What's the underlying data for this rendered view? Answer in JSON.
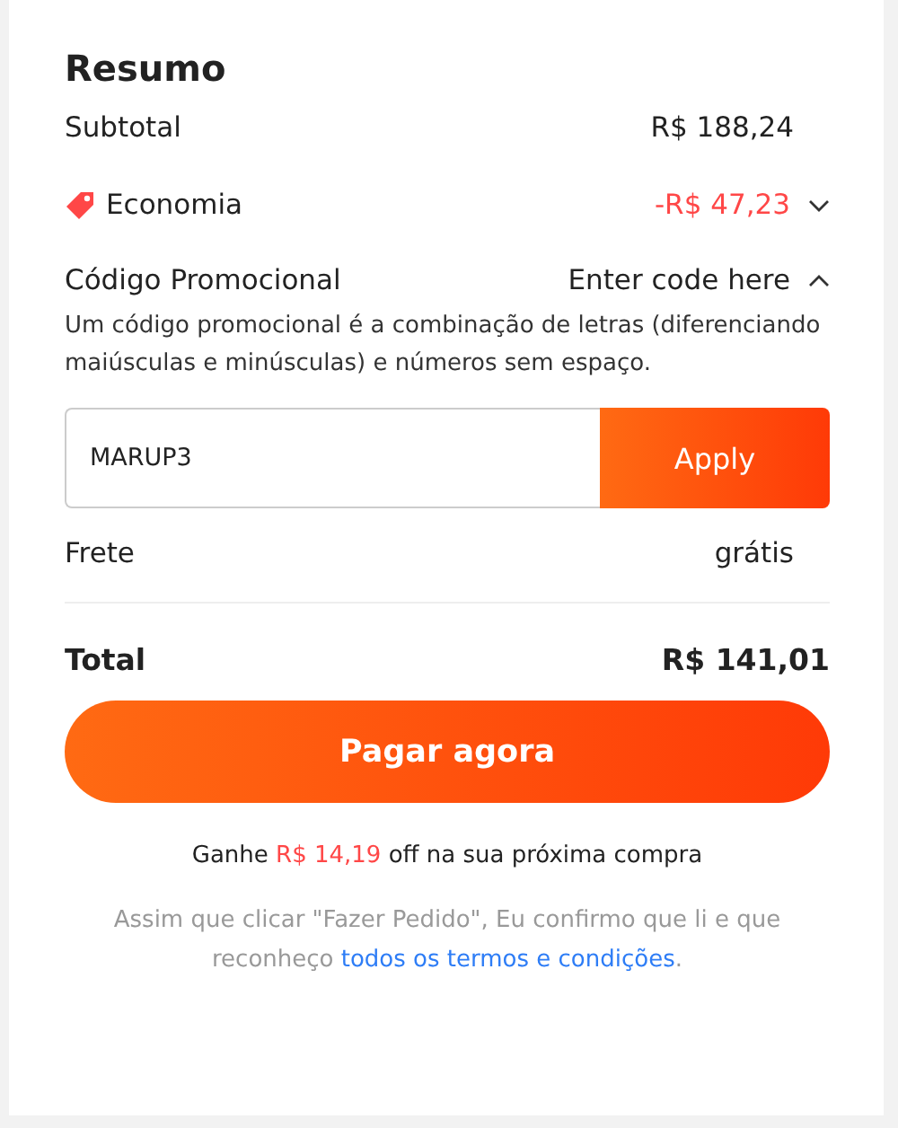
{
  "summary": {
    "title": "Resumo",
    "subtotal": {
      "label": "Subtotal",
      "value": "R$ 188,24"
    },
    "savings": {
      "label": "Economia",
      "value": "-R$ 47,23",
      "expanded": false
    },
    "promo": {
      "label": "Código Promocional",
      "action": "Enter code here",
      "expanded": true,
      "hint": "Um código promocional é a combinação de letras (diferenciando maiúsculas e minúsculas) e números sem espaço.",
      "code": "MARUP3",
      "apply": "Apply"
    },
    "shipping": {
      "label": "Frete",
      "value": "grátis"
    },
    "total": {
      "label": "Total",
      "value": "R$ 141,01"
    },
    "pay_button": "Pagar agora",
    "reward": "Ganhe **R$ 14,19** off na sua próxima compra",
    "terms": {
      "before": "Assim que clicar \"Fazer Pedido\", Eu confirmo que li e que reconheço ",
      "link": "todos os termos e condições",
      "after": "."
    }
  }
}
